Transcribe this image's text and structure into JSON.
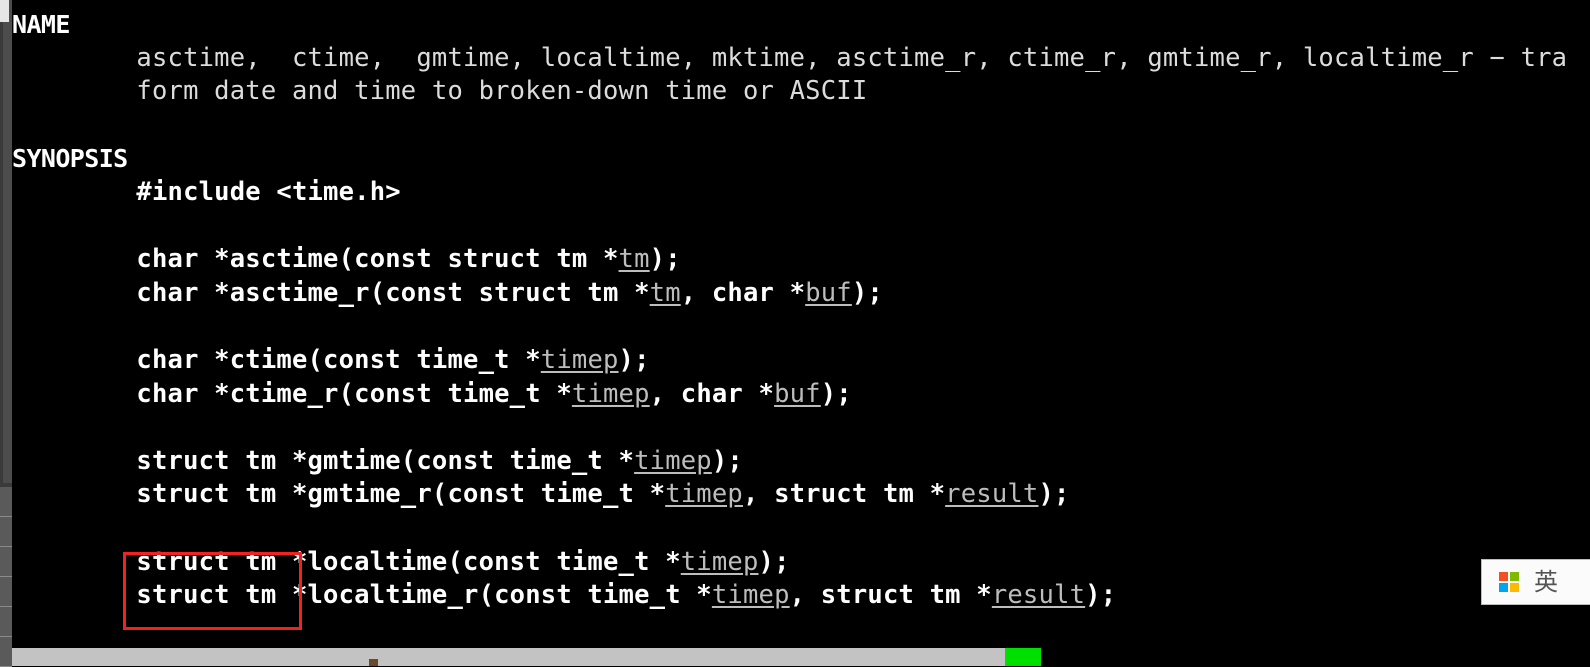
{
  "window": {
    "kind": "terminal-man-page",
    "background": "#000000",
    "text_color": "#d8d8d8",
    "accent_annotation_color": "#f02222"
  },
  "man_page": {
    "sections": [
      {
        "heading": "NAME",
        "lines": [
          [
            {
              "t": "        asctime,  ctime,  gmtime, localtime, mktime, asctime_r, ctime_r, gmtime_r, localtime_r − tra",
              "s": "plain"
            }
          ],
          [
            {
              "t": "        form date and time to broken-down time or ASCII",
              "s": "plain"
            }
          ]
        ]
      },
      {
        "heading": "SYNOPSIS",
        "lines": [
          [
            {
              "t": "        #include <time.h>",
              "s": "bold"
            }
          ],
          [],
          [
            {
              "t": "        char *asctime(const struct tm *",
              "s": "bold"
            },
            {
              "t": "tm",
              "s": "ul"
            },
            {
              "t": ");",
              "s": "bold"
            }
          ],
          [
            {
              "t": "        char *asctime_r(const struct tm *",
              "s": "bold"
            },
            {
              "t": "tm",
              "s": "ul"
            },
            {
              "t": ", char *",
              "s": "bold"
            },
            {
              "t": "buf",
              "s": "ul"
            },
            {
              "t": ");",
              "s": "bold"
            }
          ],
          [],
          [
            {
              "t": "        char *ctime(const time_t *",
              "s": "bold"
            },
            {
              "t": "timep",
              "s": "ul"
            },
            {
              "t": ");",
              "s": "bold"
            }
          ],
          [
            {
              "t": "        char *ctime_r(const time_t *",
              "s": "bold"
            },
            {
              "t": "timep",
              "s": "ul"
            },
            {
              "t": ", char *",
              "s": "bold"
            },
            {
              "t": "buf",
              "s": "ul"
            },
            {
              "t": ");",
              "s": "bold"
            }
          ],
          [],
          [
            {
              "t": "        struct tm *gmtime(const time_t *",
              "s": "bold"
            },
            {
              "t": "timep",
              "s": "ul"
            },
            {
              "t": ");",
              "s": "bold"
            }
          ],
          [
            {
              "t": "        struct tm *gmtime_r(const time_t *",
              "s": "bold"
            },
            {
              "t": "timep",
              "s": "ul"
            },
            {
              "t": ", struct tm *",
              "s": "bold"
            },
            {
              "t": "result",
              "s": "ul"
            },
            {
              "t": ");",
              "s": "bold"
            }
          ],
          [],
          [
            {
              "t": "        struct tm *localtime(const time_t *",
              "s": "bold"
            },
            {
              "t": "timep",
              "s": "ul"
            },
            {
              "t": ");",
              "s": "bold"
            }
          ],
          [
            {
              "t": "        struct tm *localtime_r(const time_t *",
              "s": "bold"
            },
            {
              "t": "timep",
              "s": "ul"
            },
            {
              "t": ", struct tm *",
              "s": "bold"
            },
            {
              "t": "result",
              "s": "ul"
            },
            {
              "t": ");",
              "s": "bold"
            }
          ]
        ]
      }
    ]
  },
  "annotation": {
    "label": "red-highlight-rectangle",
    "encloses": "struct tm *",
    "color": "#f02222"
  },
  "ime_indicator": {
    "mode_label": "英",
    "logo": "windows-logo-icon"
  },
  "taskbar": {
    "background": "#c3c3c3",
    "green_marker_color": "#00e000"
  }
}
